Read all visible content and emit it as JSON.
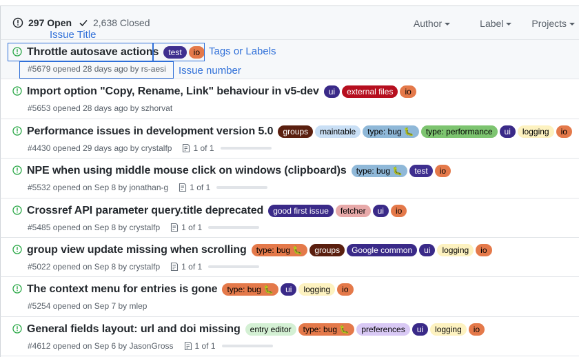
{
  "header": {
    "open_label": "297 Open",
    "closed_label": "2,638 Closed",
    "filters": [
      "Author",
      "Label",
      "Projects"
    ]
  },
  "annotations": {
    "issue_title": "Issue Title",
    "tags_or_labels": "Tags or Labels",
    "issue_number": "Issue number"
  },
  "colors": {
    "open_icon": "#28a745",
    "annotation": "#2f6fd8"
  },
  "issues": [
    {
      "title": "Throttle autosave actions",
      "meta": "#5679 opened 28 days ago by rs-aesi",
      "progress": "",
      "labels": [
        {
          "name": "test",
          "bg": "#3f2f8f",
          "fg": "#ffffff"
        },
        {
          "name": "io",
          "bg": "#e4794a",
          "fg": "#000000"
        }
      ]
    },
    {
      "title": "Import option \"Copy, Rename, Link\" behaviour in v5-dev",
      "meta": "#5653 opened 28 days ago by szhorvat",
      "progress": "",
      "labels": [
        {
          "name": "ui",
          "bg": "#3a2a88",
          "fg": "#ffffff"
        },
        {
          "name": "external files",
          "bg": "#b60f1f",
          "fg": "#ffffff"
        },
        {
          "name": "io",
          "bg": "#e4794a",
          "fg": "#000000"
        }
      ]
    },
    {
      "title": "Performance issues in development version 5.0",
      "meta": "#4430 opened 29 days ago by crystalfp",
      "progress": "1 of 1",
      "labels": [
        {
          "name": "groups",
          "bg": "#5a1f0f",
          "fg": "#ffffff"
        },
        {
          "name": "maintable",
          "bg": "#c9dff5",
          "fg": "#000000"
        },
        {
          "name": "type: bug 🐛",
          "bg": "#8fb8d8",
          "fg": "#000000"
        },
        {
          "name": "type: performance",
          "bg": "#7dc470",
          "fg": "#000000"
        },
        {
          "name": "ui",
          "bg": "#3a2a88",
          "fg": "#ffffff"
        },
        {
          "name": "logging",
          "bg": "#fdf2c0",
          "fg": "#000000"
        },
        {
          "name": "io",
          "bg": "#e4794a",
          "fg": "#000000"
        }
      ]
    },
    {
      "title": "NPE when using middle mouse click on windows (clipboard)s",
      "meta": "#5532 opened on Sep 8 by jonathan-g",
      "progress": "1 of 1",
      "labels": [
        {
          "name": "type: bug 🐛",
          "bg": "#8fb8d8",
          "fg": "#000000"
        },
        {
          "name": "test",
          "bg": "#3f2f8f",
          "fg": "#ffffff"
        },
        {
          "name": "io",
          "bg": "#e4794a",
          "fg": "#000000"
        }
      ]
    },
    {
      "title": "Crossref API parameter query.title deprecated",
      "meta": "#5485 opened on Sep 8 by crystalfp",
      "progress": "1 of 1",
      "labels": [
        {
          "name": "good first issue",
          "bg": "#3a2a88",
          "fg": "#ffffff"
        },
        {
          "name": "fetcher",
          "bg": "#e7a9a9",
          "fg": "#000000"
        },
        {
          "name": "ui",
          "bg": "#3a2a88",
          "fg": "#ffffff"
        },
        {
          "name": "io",
          "bg": "#e4794a",
          "fg": "#000000"
        }
      ]
    },
    {
      "title": "group view update missing when scrolling",
      "meta": "#5022 opened on Sep 8 by crystalfp",
      "progress": "1 of 1",
      "labels": [
        {
          "name": "type: bug 🐛",
          "bg": "#e4794a",
          "fg": "#000000"
        },
        {
          "name": "groups",
          "bg": "#5a1f0f",
          "fg": "#ffffff"
        },
        {
          "name": "Google common",
          "bg": "#3a2a88",
          "fg": "#ffffff"
        },
        {
          "name": "ui",
          "bg": "#3a2a88",
          "fg": "#ffffff"
        },
        {
          "name": "logging",
          "bg": "#fdf2c0",
          "fg": "#000000"
        },
        {
          "name": "io",
          "bg": "#e4794a",
          "fg": "#000000"
        }
      ]
    },
    {
      "title": "The context menu for entries is gone",
      "meta": "#5254 opened on Sep 7 by mlep",
      "progress": "",
      "labels": [
        {
          "name": "type: bug 🐛",
          "bg": "#e4794a",
          "fg": "#000000"
        },
        {
          "name": "ui",
          "bg": "#3a2a88",
          "fg": "#ffffff"
        },
        {
          "name": "logging",
          "bg": "#fdf2c0",
          "fg": "#000000"
        },
        {
          "name": "io",
          "bg": "#e4794a",
          "fg": "#000000"
        }
      ]
    },
    {
      "title": "General fields layout: url and doi missing",
      "meta": "#4612 opened on Sep 6 by JasonGross",
      "progress": "1 of 1",
      "labels": [
        {
          "name": "entry editor",
          "bg": "#d4f0d4",
          "fg": "#000000"
        },
        {
          "name": "type: bug 🐛",
          "bg": "#e4794a",
          "fg": "#000000"
        },
        {
          "name": "preferences",
          "bg": "#d9c9f5",
          "fg": "#000000"
        },
        {
          "name": "ui",
          "bg": "#3a2a88",
          "fg": "#ffffff"
        },
        {
          "name": "logging",
          "bg": "#fdf2c0",
          "fg": "#000000"
        },
        {
          "name": "io",
          "bg": "#e4794a",
          "fg": "#000000"
        }
      ]
    }
  ]
}
